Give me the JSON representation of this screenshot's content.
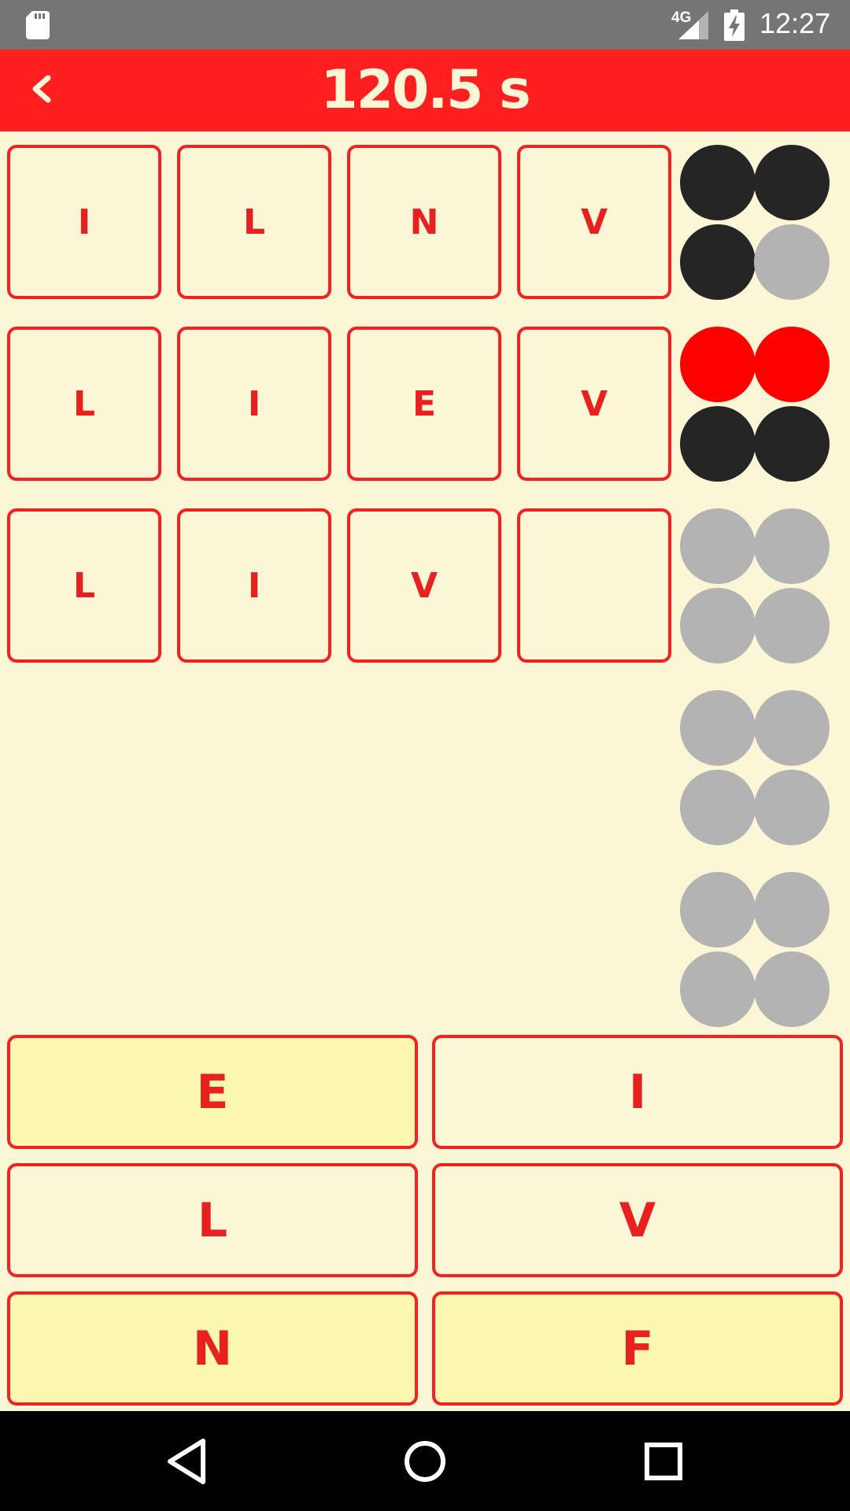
{
  "status": {
    "network": "4G",
    "time": "12:27"
  },
  "header": {
    "timer": "120.5 s"
  },
  "board": {
    "rows": [
      {
        "letters": [
          "I",
          "L",
          "N",
          "V"
        ],
        "pegs": [
          "black",
          "black",
          "black",
          "grey"
        ]
      },
      {
        "letters": [
          "L",
          "I",
          "E",
          "V"
        ],
        "pegs": [
          "red",
          "red",
          "black",
          "black"
        ]
      },
      {
        "letters": [
          "L",
          "I",
          "V",
          ""
        ],
        "pegs": [
          "grey",
          "grey",
          "grey",
          "grey"
        ]
      },
      {
        "letters": [],
        "pegs": [
          "grey",
          "grey",
          "grey",
          "grey"
        ]
      },
      {
        "letters": [],
        "pegs": [
          "grey",
          "grey",
          "grey",
          "grey"
        ]
      }
    ]
  },
  "keys": [
    {
      "label": "E",
      "style": "highlight"
    },
    {
      "label": "I",
      "style": "light"
    },
    {
      "label": "L",
      "style": "light"
    },
    {
      "label": "V",
      "style": "light"
    },
    {
      "label": "N",
      "style": "highlight"
    },
    {
      "label": "F",
      "style": "highlight"
    }
  ],
  "colors": {
    "accent": "#FF1F1F",
    "background": "#FBF6D6",
    "peg_black": "#252525",
    "peg_red": "#FF0000",
    "peg_empty": "#B3B3B3"
  },
  "icons": {
    "back": "chevron-left-icon",
    "nav_back": "triangle-back-icon",
    "nav_home": "circle-home-icon",
    "nav_recents": "square-recents-icon"
  }
}
